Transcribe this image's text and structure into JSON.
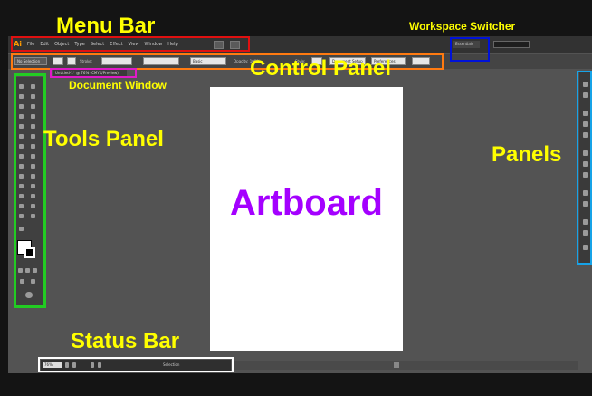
{
  "app": {
    "logo": "Ai",
    "menu": [
      "File",
      "Edit",
      "Object",
      "Type",
      "Select",
      "Effect",
      "View",
      "Window",
      "Help"
    ],
    "workspace_value": "Essentials",
    "control_panel_items": [
      "No Selection",
      "Stroke:",
      "Basic",
      "Opacity: 100%",
      "Style:",
      "Document Setup",
      "Preferences"
    ],
    "document_tab": "Untitled-1* @ 76% (CMYK/Preview)",
    "status_zoom": "76%",
    "status_tool": "Selection"
  },
  "labels": {
    "menu_bar": "Menu Bar",
    "workspace_switcher": "Workspace Switcher",
    "control_panel": "Control Panel",
    "document_window": "Document Window",
    "tools_panel": "Tools Panel",
    "panels": "Panels",
    "artboard": "Artboard",
    "status_bar": "Status Bar"
  },
  "colors": {
    "label_yellow": "#ffff00",
    "artboard_text": "#a400ff",
    "menu_bar_box": "#e01010",
    "control_panel_box": "#ff7a10",
    "workspace_box": "#0012d8",
    "document_window_box": "#e01ac8",
    "tools_panel_box": "#22cc22",
    "panels_box": "#16a3e8",
    "status_bar_box": "#ffffff"
  }
}
